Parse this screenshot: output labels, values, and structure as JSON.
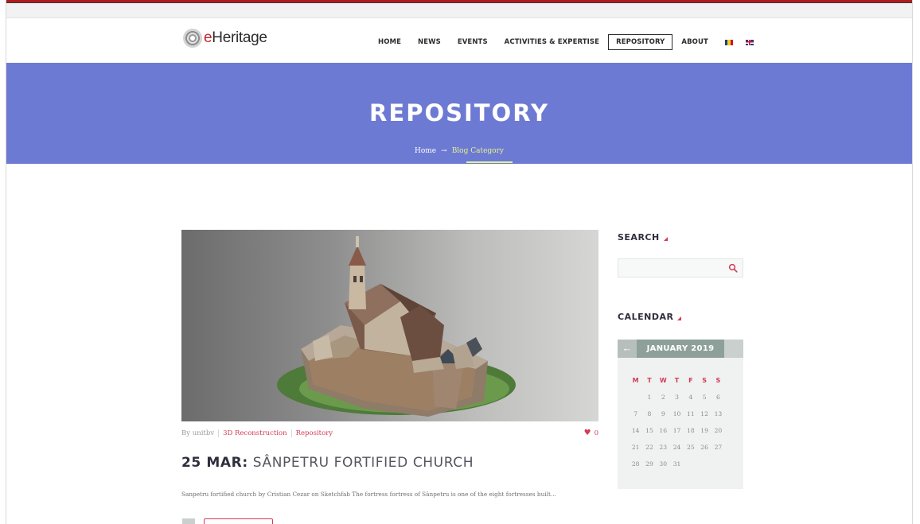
{
  "brand": {
    "logo_prefix": "e",
    "logo_text": "Heritage"
  },
  "nav": {
    "items": [
      "HOME",
      "NEWS",
      "EVENTS",
      "ACTIVITIES & EXPERTISE",
      "REPOSITORY",
      "ABOUT"
    ],
    "active": "REPOSITORY",
    "flags": [
      "romanian-flag-icon",
      "uk-flag-icon"
    ]
  },
  "banner": {
    "title": "REPOSITORY",
    "breadcrumb": {
      "home": "Home",
      "arrow": "→",
      "current": "Blog Category"
    },
    "color": "#6d7ad3"
  },
  "post": {
    "author": "By unitbv",
    "categories": [
      "3D Reconstruction",
      "Repository"
    ],
    "likes": "0",
    "date": "25 MAR:",
    "title": "SÂNPETRU FORTIFIED CHURCH",
    "excerpt": "Sanpetru fortified church by Cristian Cezar on Sketchfab The fortress fortress of Sânpetru is one of the eight fortresses built..."
  },
  "sidebar": {
    "search": {
      "title": "SEARCH",
      "placeholder": ""
    },
    "calendar": {
      "title": "CALENDAR",
      "prev_icon": "←",
      "month": "JANUARY 2019",
      "weekdays": [
        "M",
        "T",
        "W",
        "T",
        "F",
        "S",
        "S"
      ],
      "weeks": [
        [
          "",
          "1",
          "2",
          "3",
          "4",
          "5",
          "6"
        ],
        [
          "7",
          "8",
          "9",
          "10",
          "11",
          "12",
          "13"
        ],
        [
          "14",
          "15",
          "16",
          "17",
          "18",
          "19",
          "20"
        ],
        [
          "21",
          "22",
          "23",
          "24",
          "25",
          "26",
          "27"
        ],
        [
          "28",
          "29",
          "30",
          "31",
          "",
          "",
          ""
        ]
      ]
    }
  },
  "colors": {
    "accent": "#d23b54",
    "banner": "#6d7ad3",
    "highlight": "#e6f28a"
  }
}
